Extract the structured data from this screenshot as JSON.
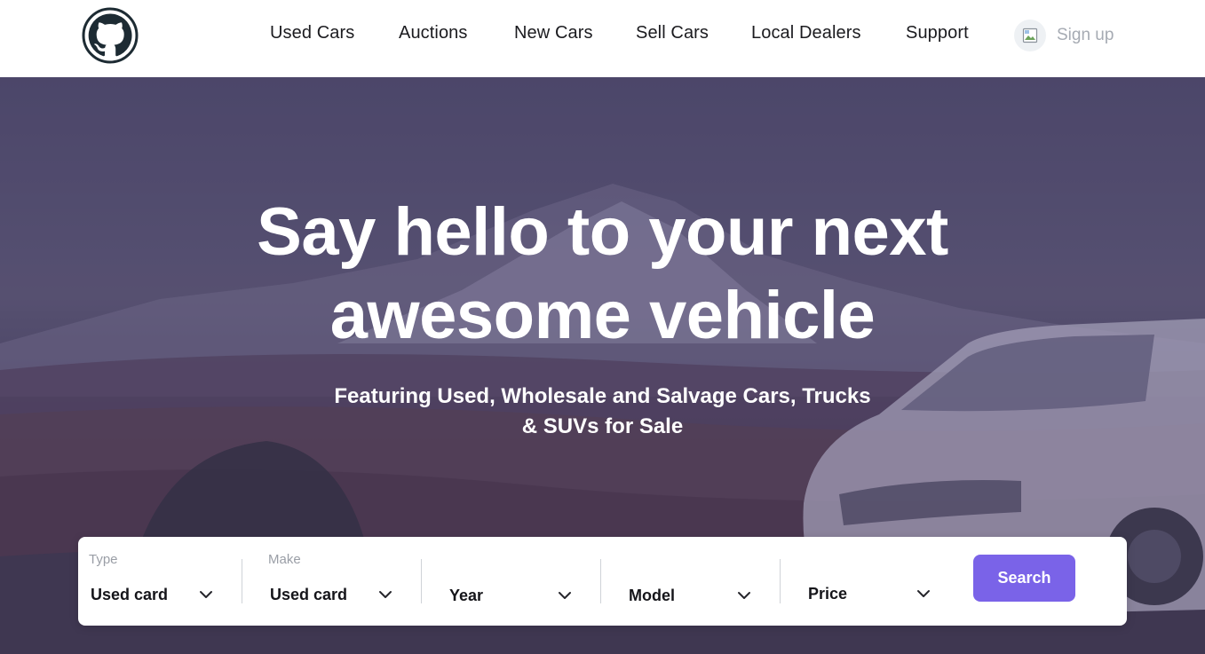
{
  "header": {
    "nav": [
      {
        "label": "Used Cars"
      },
      {
        "label": "Auctions"
      },
      {
        "label": "New Cars"
      },
      {
        "label": "Sell Cars"
      },
      {
        "label": "Local Dealers"
      },
      {
        "label": "Support"
      }
    ],
    "signup_label": "Sign up",
    "logo_icon": "github-octocat-icon",
    "avatar_icon": "broken-image-icon"
  },
  "hero": {
    "headline_line1": "Say hello to your next",
    "headline_line2": "awesome vehicle",
    "subhead_line1": "Featuring Used, Wholesale and Salvage Cars, Trucks",
    "subhead_line2": "& SUVs for Sale"
  },
  "search": {
    "fields": [
      {
        "label": "Type",
        "value": "Used card"
      },
      {
        "label": "Make",
        "value": "Used card"
      },
      {
        "label": "",
        "value": "Year"
      },
      {
        "label": "",
        "value": "Model"
      },
      {
        "label": "",
        "value": "Price"
      }
    ],
    "button_label": "Search",
    "chevron_icon": "chevron-down-icon"
  },
  "colors": {
    "accent": "#7a63e8",
    "nav_text": "#1b1b1f",
    "hero_overlay": "#4f4a68"
  }
}
